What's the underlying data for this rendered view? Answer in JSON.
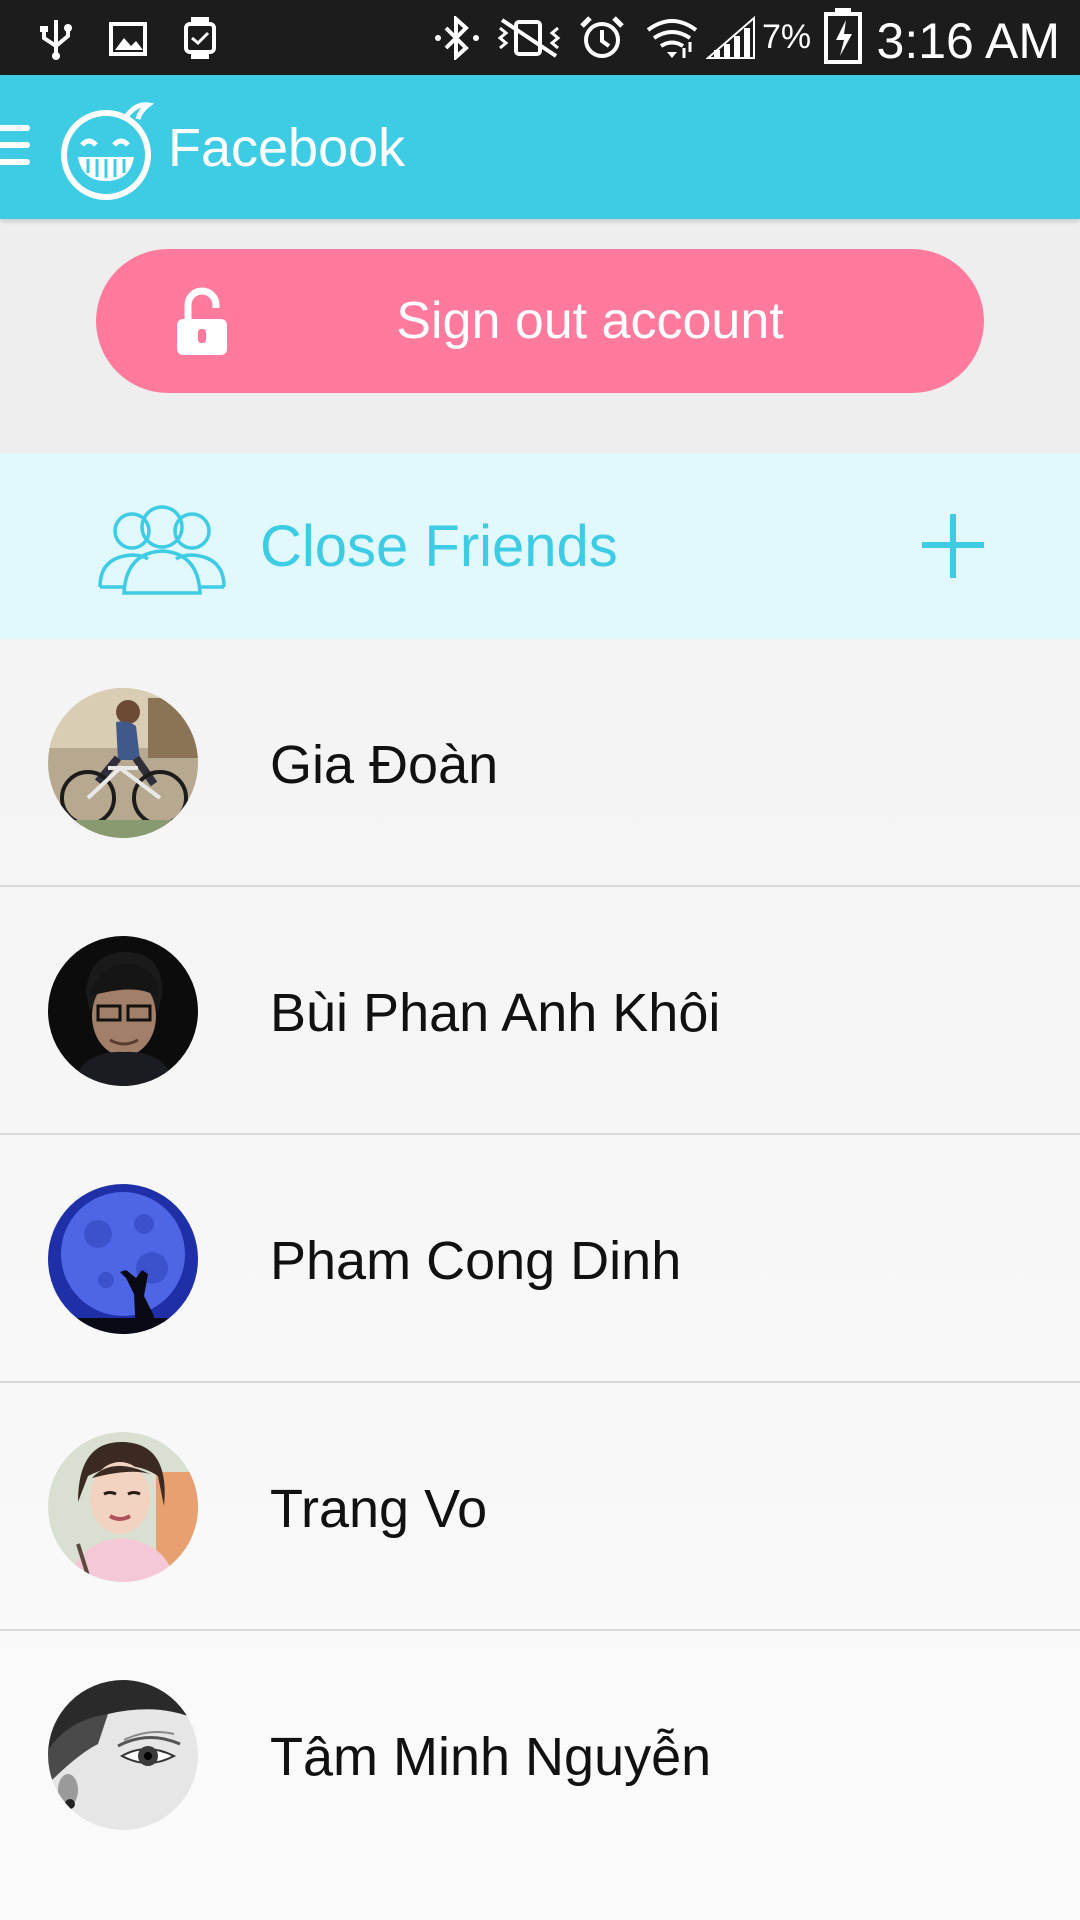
{
  "status_bar": {
    "battery_percent": "7%",
    "time": "3:16 AM",
    "icons": [
      "usb-icon",
      "image-icon",
      "watch-icon",
      "bluetooth-icon",
      "mute-vibrate-icon",
      "alarm-icon",
      "wifi-icon",
      "signal-icon",
      "battery-charging-icon"
    ]
  },
  "app_bar": {
    "title": "Facebook",
    "menu_icon": "hamburger-menu-icon",
    "logo_icon": "grinning-face-logo-icon",
    "background_color": "#3dcce4"
  },
  "sign_out": {
    "label": "Sign out account",
    "icon": "unlocked-padlock-icon",
    "color": "#ff7a9c"
  },
  "section": {
    "title": "Close Friends",
    "icon": "group-icon",
    "action_icon": "plus-icon",
    "accent_color": "#3dcce4"
  },
  "friends": [
    {
      "name": "Gia Đoàn",
      "avatar": "cyclist-photo"
    },
    {
      "name": "Bùi Phan Anh Khôi",
      "avatar": "man-with-glasses-photo"
    },
    {
      "name": "Pham Cong Dinh",
      "avatar": "wolf-moon-photo"
    },
    {
      "name": "Trang Vo",
      "avatar": "smiling-woman-photo"
    },
    {
      "name": "Tâm Minh Nguyễn",
      "avatar": "eye-closeup-photo"
    }
  ]
}
